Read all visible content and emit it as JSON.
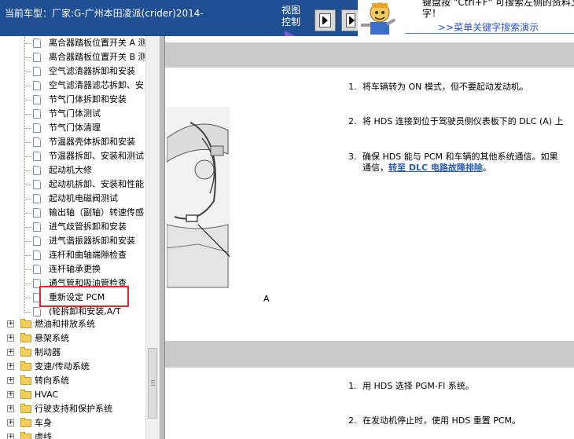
{
  "header": {
    "vehicle_label": "当前车型：厂家:G-广州本田凌派(crider)2014-",
    "view_control_line1": "视图",
    "view_control_line2": "控制"
  },
  "hint_panel": {
    "line1": "键盘按 \"Ctrl+F\" 可搜索左侧的资料文",
    "line2": "字！",
    "link": ">>菜单关键字搜索演示"
  },
  "tree": {
    "leaf_items": [
      "离合器踏板位置开关 A 测",
      "离合器踏板位置开关 B 测",
      "空气滤清器拆卸和安装",
      "空气滤清器滤芯拆卸、安",
      "节气门体拆卸和安装",
      "节气门体测试",
      "节气门体清理",
      "节温器壳体拆卸和安装",
      "节温器拆卸、安装和测试",
      "起动机大修",
      "起动机拆卸、安装和性能",
      "起动机电磁阀测试",
      "输出轴（副轴）转速传感",
      "进气歧管拆卸和安装",
      "进气谐振器拆卸和安装",
      "连杆和曲轴端隙检查",
      "连杆轴承更换",
      "通气管和吸油管检查",
      "重新设定 PCM",
      "(轮拆卸和安装,A/T"
    ],
    "folders": [
      "燃油和排放系统",
      "悬架系统",
      "制动器",
      "变速/传动系统",
      "转向系统",
      "HVAC",
      "行驶支持和保护系统",
      "车身",
      "虚线"
    ]
  },
  "content": {
    "figure_callout": "A",
    "section1_steps": [
      {
        "num": "1.",
        "text": "将车辆转为 ON 模式，但不要起动发动机。"
      },
      {
        "num": "2.",
        "text": "将 HDS 连接到位于驾驶员侧仪表板下的 DLC (A) 上"
      },
      {
        "num": "3.",
        "text": "确保 HDS 能与 PCM 和车辆的其他系统通信。如果"
      }
    ],
    "step3_cont_prefix": "通信，",
    "step3_link": "转至 DLC 电路故障排除",
    "step3_cont_suffix": "。",
    "section2_steps": [
      {
        "num": "1.",
        "text": "用 HDS 选择 PGM-FI 系统。"
      },
      {
        "num": "2.",
        "text": "在发动机停止时，使用 HDS 重置 PCM。"
      }
    ]
  },
  "colors": {
    "title_bar": "#1f4f94",
    "highlight_border": "#e2272a",
    "link": "#2a5db0",
    "section_band": "#c9c9c9"
  }
}
